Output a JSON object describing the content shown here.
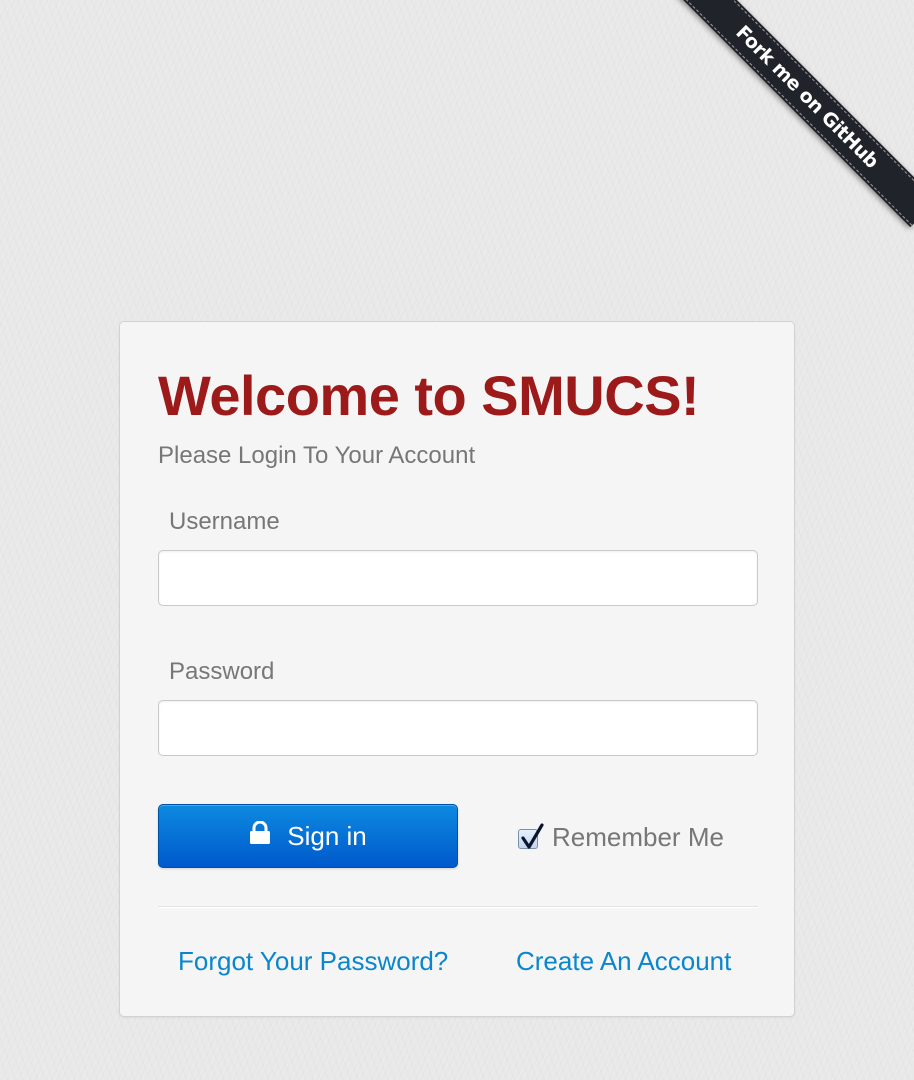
{
  "ribbon": {
    "label": "Fork me on GitHub"
  },
  "login": {
    "title": "Welcome to SMUCS!",
    "subtitle": "Please Login To Your Account",
    "username_label": "Username",
    "username_value": "",
    "password_label": "Password",
    "password_value": "",
    "signin_label": "Sign in",
    "remember_label": "Remember Me",
    "remember_checked": true,
    "forgot_link": "Forgot Your Password?",
    "create_link": "Create An Account"
  },
  "icons": {
    "signin": "lock-icon",
    "remember": "checkmark-icon"
  },
  "colors": {
    "title": "#9c1a1a",
    "primary_button": "#0a6fd8",
    "link": "#0a86cc",
    "ribbon": "#20232a"
  }
}
